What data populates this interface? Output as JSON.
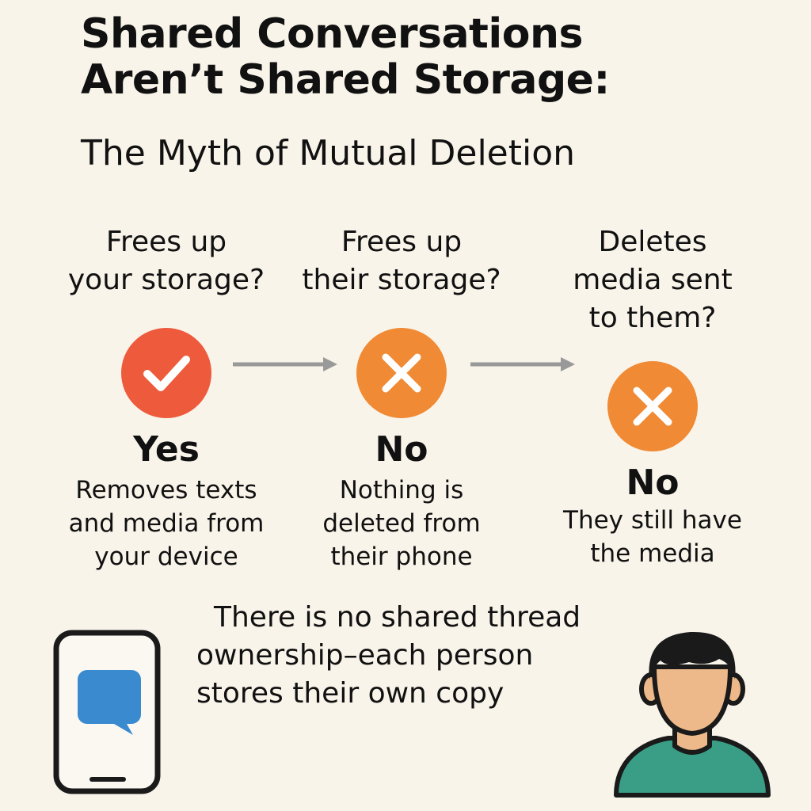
{
  "header": {
    "title_line1": "Shared Conversations",
    "title_line2": "Aren’t Shared Storage:",
    "subtitle": "The Myth of Mutual Deletion"
  },
  "columns": [
    {
      "question_line1": "Frees up",
      "question_line2": "your storage?",
      "icon": "check-icon",
      "badge_color": "#ee5a3c",
      "answer": "Yes",
      "desc_line1": "Removes texts",
      "desc_line2": "and media from",
      "desc_line3": "your device"
    },
    {
      "question_line1": "Frees up",
      "question_line2": "their storage?",
      "icon": "x-icon",
      "badge_color": "#f08a34",
      "answer": "No",
      "desc_line1": "Nothing is",
      "desc_line2": "deleted from",
      "desc_line3": "their phone"
    },
    {
      "question_line1": "Deletes",
      "question_line2": "media sent",
      "question_line3": "to them?",
      "icon": "x-icon",
      "badge_color": "#f08a34",
      "answer": "No",
      "desc_line1": "They still have",
      "desc_line2": "the media"
    }
  ],
  "note": {
    "line1": "There is no shared thread",
    "line2": "ownership–each person",
    "line3": "stores their own copy"
  },
  "colors": {
    "background": "#f9f4ea",
    "arrow": "#999999",
    "chat_bubble": "#3a8ad0",
    "person_skin": "#eeb98a",
    "person_shirt": "#3a9e86",
    "outline": "#1a1a1a"
  }
}
